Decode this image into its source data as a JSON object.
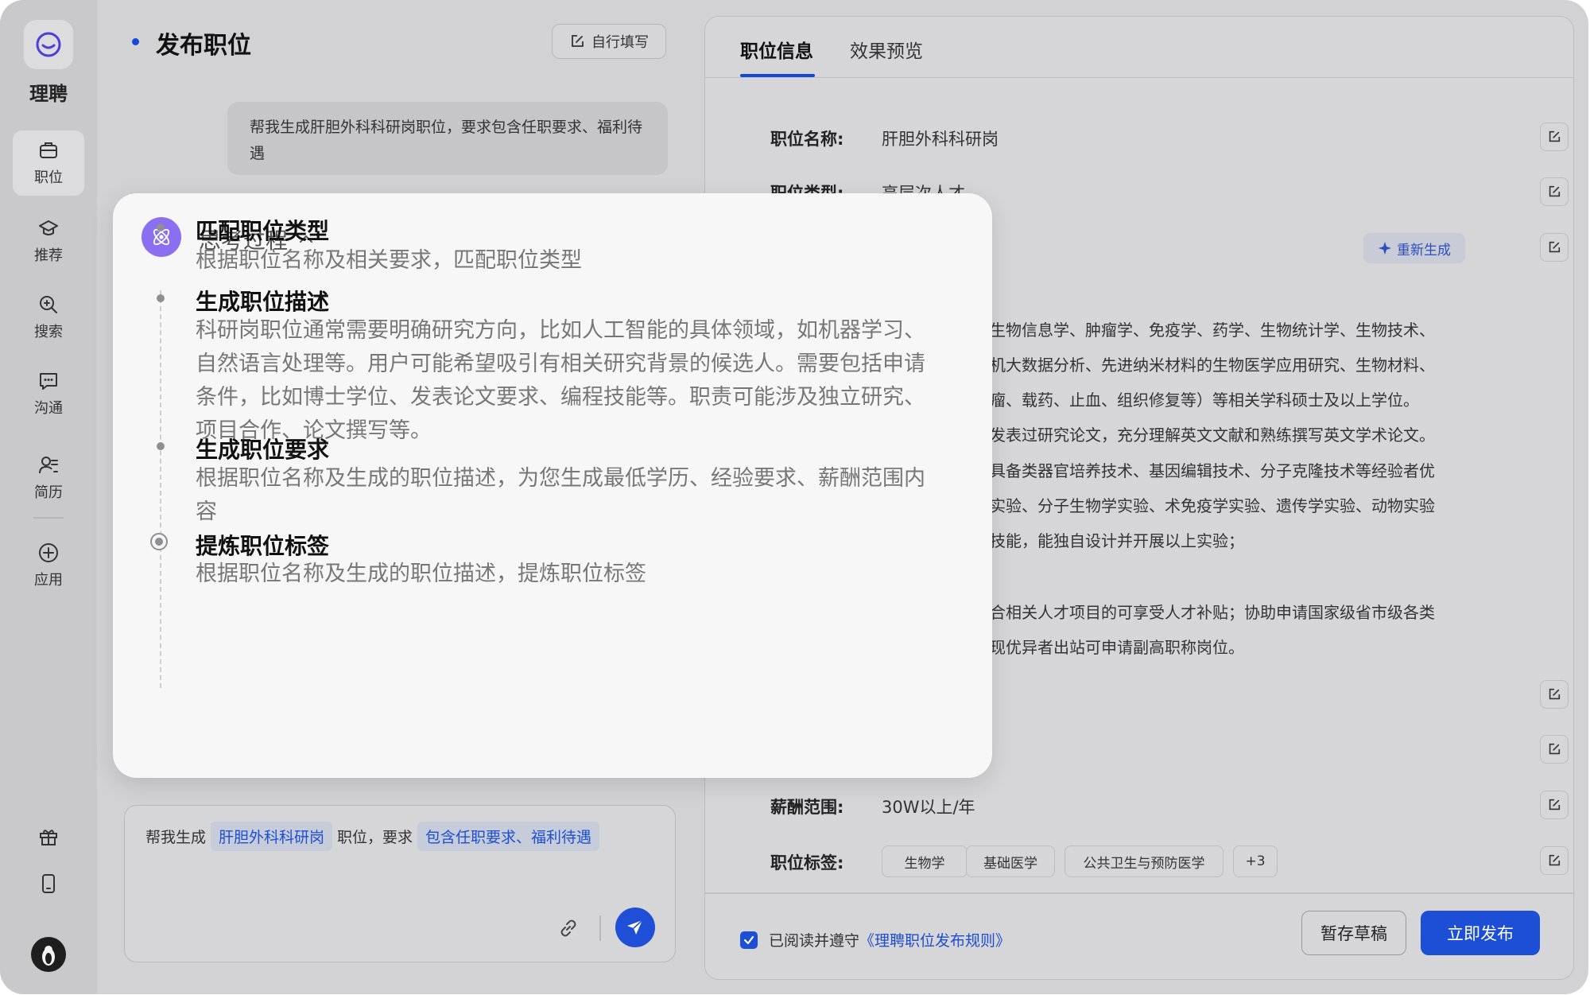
{
  "app": {
    "brand": "理聘"
  },
  "sidebar": {
    "items": [
      {
        "label": "职位",
        "icon": "briefcase-icon",
        "active": true
      },
      {
        "label": "推荐",
        "icon": "graduation-cap-icon"
      },
      {
        "label": "搜索",
        "icon": "search-icon"
      },
      {
        "label": "沟通",
        "icon": "chat-icon"
      },
      {
        "label": "简历",
        "icon": "resume-user-icon"
      },
      {
        "label": "应用",
        "icon": "plus-circle-icon"
      }
    ]
  },
  "page": {
    "title": "发布职位",
    "self_fill_label": "自行填写"
  },
  "chat": {
    "user_message": "帮我生成肝胆外科科研岗职位，要求包含任职要求、福利待遇",
    "input": {
      "prefix": "帮我生成",
      "chip_position": "肝胆外科科研岗",
      "middle": "职位，要求",
      "chip_requirements": "包含任职要求、福利待遇"
    }
  },
  "thinking": {
    "title": "思考过程",
    "steps": [
      {
        "title": "匹配职位类型",
        "desc": "根据职位名称及相关要求，匹配职位类型"
      },
      {
        "title": "生成职位描述",
        "desc": "科研岗职位通常需要明确研究方向，比如人工智能的具体领域，如机器学习、自然语言处理等。用户可能希望吸引有相关研究背景的候选人。需要包括申请条件，比如博士学位、发表论文要求、编程技能等。职责可能涉及独立研究、项目合作、论文撰写等。"
      },
      {
        "title": "生成职位要求",
        "desc": "根据职位名称及生成的职位描述，为您生成最低学历、经验要求、薪酬范围内容"
      },
      {
        "title": "提炼职位标签",
        "desc": "根据职位名称及生成的职位描述，提炼职位标签",
        "current": true
      }
    ]
  },
  "panel": {
    "tabs": [
      "职位信息",
      "效果预览"
    ],
    "active_tab": 0,
    "fields": {
      "name_label": "职位名称:",
      "name_value": "肝胆外科科研岗",
      "type_label": "职位类型:",
      "type_value": "高层次人才",
      "salary_label": "薪酬范围:",
      "salary_value": "30W以上/年",
      "tags_label": "职位标签:"
    },
    "regenerate_label": "重新生成",
    "description_lines": [
      "生物信息学、肿瘤学、免疫学、药学、生物统计学、生物技术、",
      "机大数据分析、先进纳米材料的生物医学应用研究、生物材料、",
      "瘤、载药、止血、组织修复等）等相关学科硕士及以上学位。",
      "发表过研究论文，充分理解英文文献和熟练撰写英文学术论文。",
      "具备类器官培养技术、基因编辑技术、分子克隆技术等经验者优",
      "实验、分子生物学实验、术免疫学实验、遗传学实验、动物实验",
      "技能，能独自设计并开展以上实验；",
      "合相关人才项目的可享受人才补贴；协助申请国家级省市级各类",
      "现优异者出站可申请副高职称岗位。"
    ],
    "tags": [
      "生物学",
      "基础医学",
      "公共卫生与预防医学",
      "+3"
    ],
    "agree_text": "已阅读并遵守",
    "agree_link": "《理聘职位发布规则》",
    "draft_label": "暂存草稿",
    "publish_label": "立即发布"
  },
  "colors": {
    "accent": "#1d4fd6",
    "think_icon": "#8a6ff0"
  }
}
